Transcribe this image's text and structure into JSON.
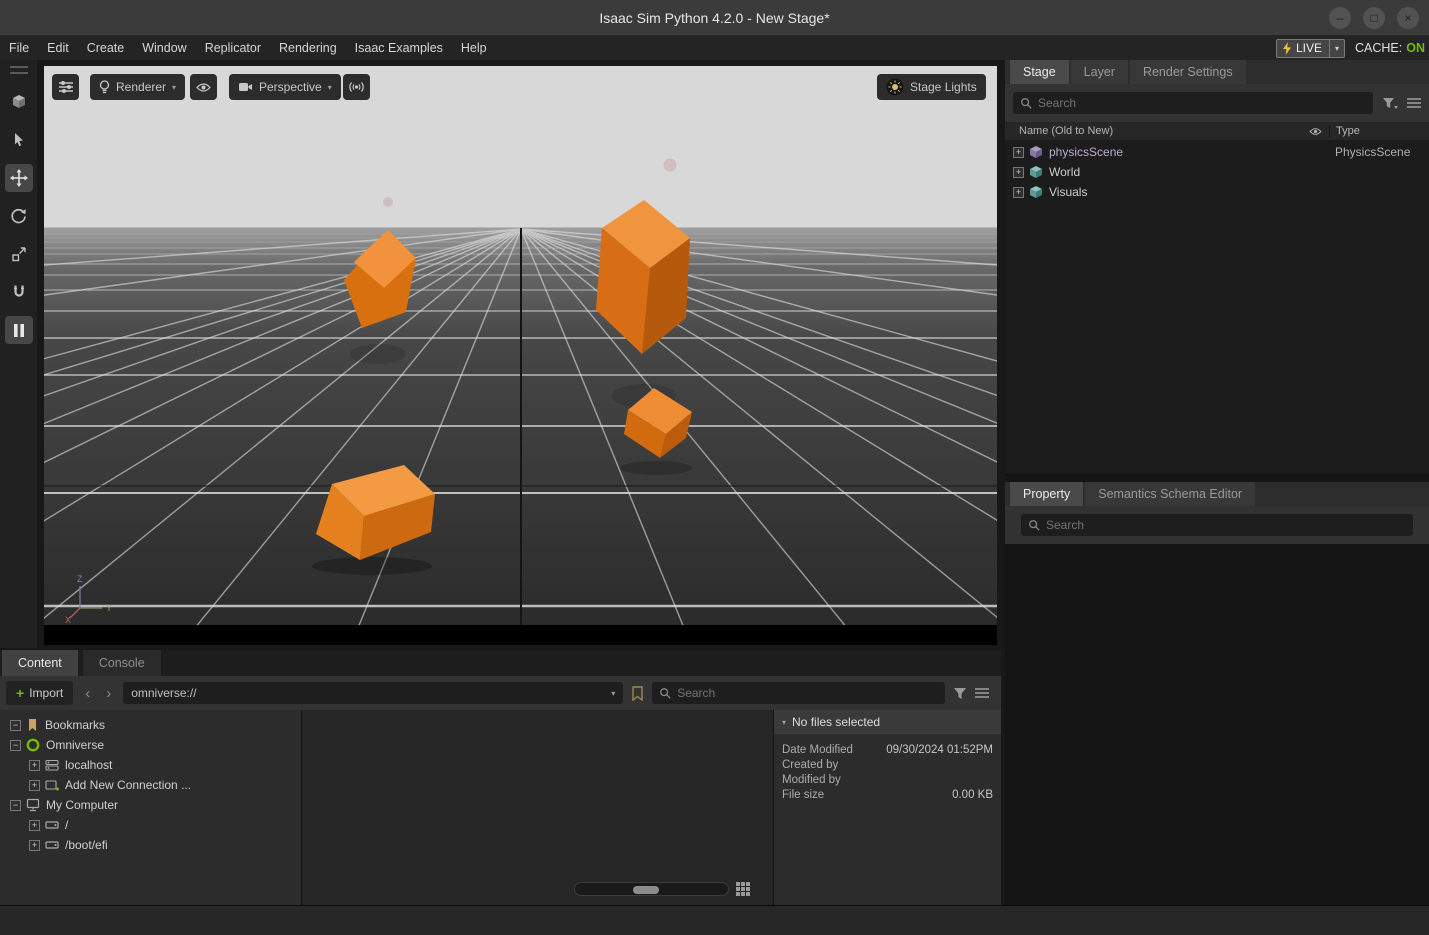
{
  "titlebar": {
    "title": "Isaac Sim Python 4.2.0 - New Stage*"
  },
  "icons": {
    "minimize": "–",
    "maximize": "□",
    "close": "×",
    "back": "‹",
    "forward": "›",
    "caret_down": "▾",
    "plus": "+"
  },
  "menubar": {
    "items": [
      "File",
      "Edit",
      "Create",
      "Window",
      "Replicator",
      "Rendering",
      "Isaac Examples",
      "Help"
    ],
    "live_label": "LIVE",
    "cache_label": "CACHE:",
    "cache_value": "ON"
  },
  "viewport": {
    "renderer_label": "Renderer",
    "perspective_label": "Perspective",
    "stage_lights_label": "Stage Lights",
    "axis": {
      "x": "X",
      "y": "Y",
      "z": "Z"
    }
  },
  "stage_panel": {
    "tabs": [
      "Stage",
      "Layer",
      "Render Settings"
    ],
    "search_placeholder": "Search",
    "name_column": "Name (Old to New)",
    "type_column": "Type",
    "rows": [
      {
        "name": "physicsScene",
        "type": "PhysicsScene",
        "expand": "+"
      },
      {
        "name": "World",
        "type": "",
        "expand": "+"
      },
      {
        "name": "Visuals",
        "type": "",
        "expand": "+"
      }
    ]
  },
  "property_panel": {
    "tabs": [
      "Property",
      "Semantics Schema Editor"
    ],
    "search_placeholder": "Search"
  },
  "content_panel": {
    "tabs": [
      "Content",
      "Console"
    ],
    "import_label": "Import",
    "path_value": "omniverse://",
    "search_placeholder": "Search",
    "tree": [
      {
        "label": "Bookmarks",
        "expand": "−"
      },
      {
        "label": "Omniverse",
        "expand": "−"
      },
      {
        "label": "localhost",
        "expand": "+"
      },
      {
        "label": "Add New Connection ...",
        "expand": "+"
      },
      {
        "label": "My Computer",
        "expand": "−"
      },
      {
        "label": "/",
        "expand": "+"
      },
      {
        "label": "/boot/efi",
        "expand": "+"
      }
    ],
    "details": {
      "header": "No files selected",
      "rows": [
        {
          "label": "Date Modified",
          "value": "09/30/2024 01:52PM"
        },
        {
          "label": "Created by",
          "value": ""
        },
        {
          "label": "Modified by",
          "value": ""
        },
        {
          "label": "File size",
          "value": "0.00 KB"
        }
      ]
    }
  },
  "colors": {
    "accent_green": "#76b900",
    "cube_orange": "#e0761e",
    "sky_gray": "#d8d8d8"
  }
}
